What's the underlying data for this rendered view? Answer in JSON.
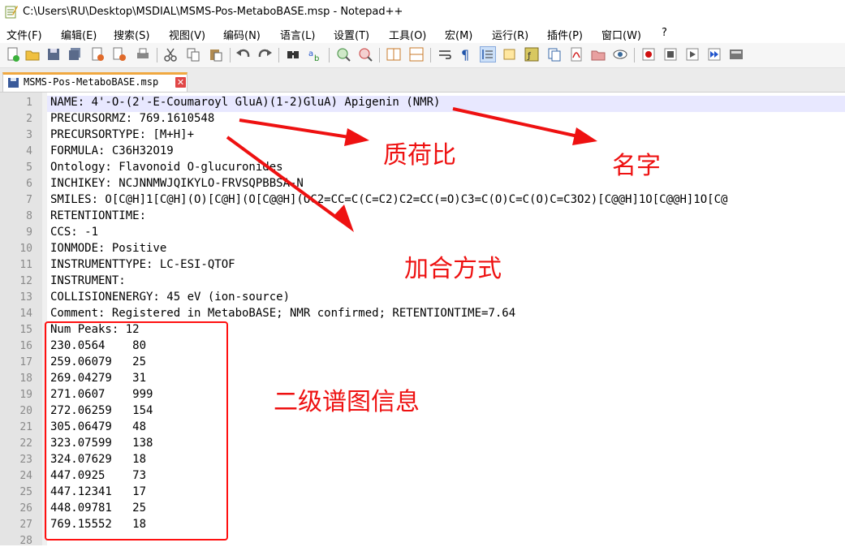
{
  "window": {
    "title": "C:\\Users\\RU\\Desktop\\MSDIAL\\MSMS-Pos-MetaboBASE.msp - Notepad++"
  },
  "menu": [
    "文件(F)",
    "编辑(E)",
    "搜索(S)",
    "视图(V)",
    "编码(N)",
    "语言(L)",
    "设置(T)",
    "工具(O)",
    "宏(M)",
    "运行(R)",
    "插件(P)",
    "窗口(W)",
    "?"
  ],
  "toolbar": {
    "icons": [
      "new-file-icon",
      "open-file-icon",
      "save-icon",
      "save-all-icon",
      "close-icon",
      "close-all-icon",
      "print-icon",
      "cut-icon",
      "copy-icon",
      "paste-icon",
      "undo-icon",
      "redo-icon",
      "find-icon",
      "replace-icon",
      "zoom-in-icon",
      "zoom-out-icon",
      "sync-vertical-icon",
      "sync-horizontal-icon",
      "word-wrap-icon",
      "show-all-chars-icon",
      "indent-guide-icon",
      "document-map-icon",
      "function-list-icon",
      "folder-workspace-icon",
      "pdf-icon",
      "folder-icon",
      "monitoring-icon",
      "record-macro-icon",
      "stop-macro-icon",
      "play-macro-icon",
      "run-macro-multiple-icon",
      "save-macro-icon"
    ]
  },
  "tab": {
    "label": "MSMS-Pos-MetaboBASE.msp",
    "close": "✕"
  },
  "lines": [
    {
      "num": "1",
      "text": "NAME: 4'-O-(2'-E-Coumaroyl GluA)(1-2)GluA) Apigenin (NMR)"
    },
    {
      "num": "2",
      "text": "PRECURSORMZ: 769.1610548"
    },
    {
      "num": "3",
      "text": "PRECURSORTYPE: [M+H]+"
    },
    {
      "num": "4",
      "text": "FORMULA: C36H32O19"
    },
    {
      "num": "5",
      "text": "Ontology: Flavonoid O-glucuronides"
    },
    {
      "num": "6",
      "text": "INCHIKEY: NCJNNMWJQIKYLO-FRVSQPBBSA-N"
    },
    {
      "num": "7",
      "text": "SMILES: O[C@H]1[C@H](O)[C@H](O[C@@H](OC2=CC=C(C=C2)C2=CC(=O)C3=C(O)C=C(O)C=C3O2)[C@@H]1O[C@@H]1O[C@"
    },
    {
      "num": "8",
      "text": "RETENTIONTIME:"
    },
    {
      "num": "9",
      "text": "CCS: -1"
    },
    {
      "num": "10",
      "text": "IONMODE: Positive"
    },
    {
      "num": "11",
      "text": "INSTRUMENTTYPE: LC-ESI-QTOF"
    },
    {
      "num": "12",
      "text": "INSTRUMENT:"
    },
    {
      "num": "13",
      "text": "COLLISIONENERGY: 45 eV (ion-source)"
    },
    {
      "num": "14",
      "text": "Comment: Registered in MetaboBASE; NMR confirmed; RETENTIONTIME=7.64"
    },
    {
      "num": "15",
      "text": "Num Peaks: 12"
    },
    {
      "num": "16",
      "text": "230.0564    80"
    },
    {
      "num": "17",
      "text": "259.06079   25"
    },
    {
      "num": "18",
      "text": "269.04279   31"
    },
    {
      "num": "19",
      "text": "271.0607    999"
    },
    {
      "num": "20",
      "text": "272.06259   154"
    },
    {
      "num": "21",
      "text": "305.06479   48"
    },
    {
      "num": "22",
      "text": "323.07599   138"
    },
    {
      "num": "23",
      "text": "324.07629   18"
    },
    {
      "num": "24",
      "text": "447.0925    73"
    },
    {
      "num": "25",
      "text": "447.12341   17"
    },
    {
      "num": "26",
      "text": "448.09781   25"
    },
    {
      "num": "27",
      "text": "769.15552   18"
    },
    {
      "num": "28",
      "text": ""
    }
  ],
  "annotations": {
    "mz_label": "质荷比",
    "name_label": "名字",
    "adduct_label": "加合方式",
    "msms_label": "二级谱图信息",
    "color": "#ee1111"
  }
}
